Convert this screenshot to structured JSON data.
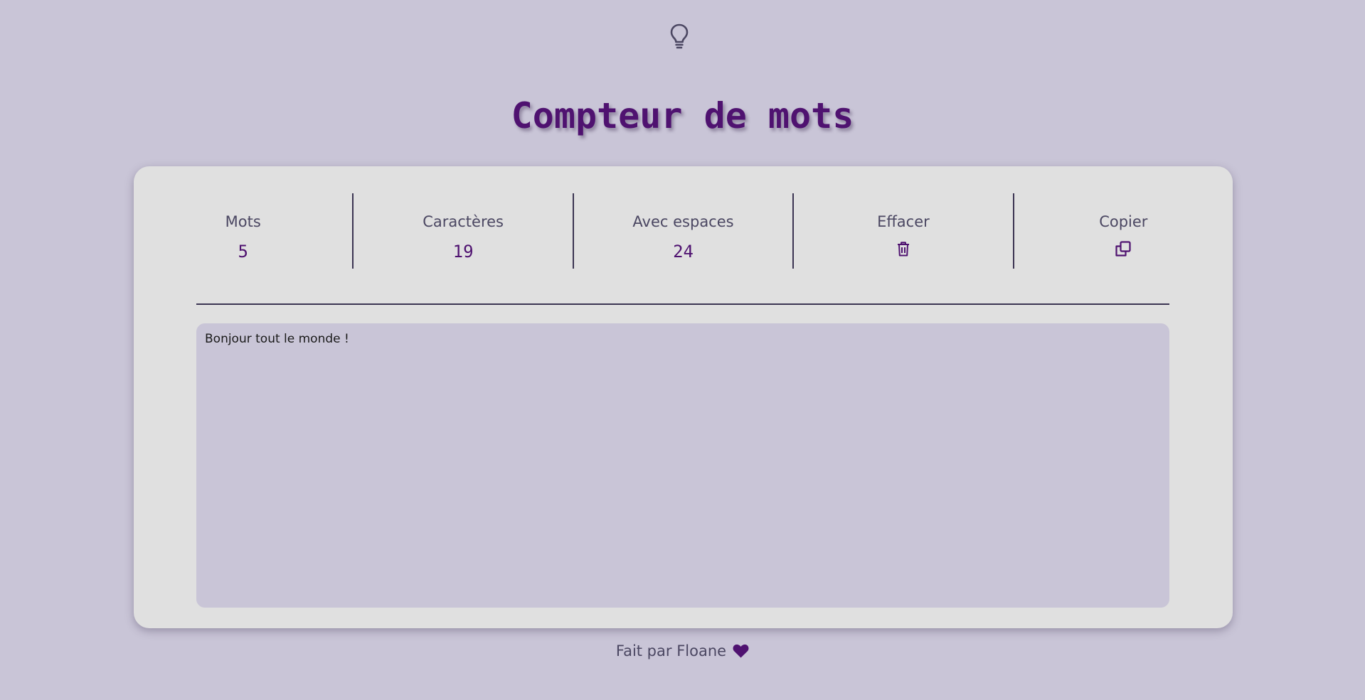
{
  "header": {
    "theme_toggle_icon": "lightbulb-icon",
    "title": "Compteur de mots"
  },
  "stats": [
    {
      "label": "Mots",
      "value": "5"
    },
    {
      "label": "Caractères",
      "value": "19"
    },
    {
      "label": "Avec espaces",
      "value": "24"
    }
  ],
  "actions": {
    "clear": {
      "label": "Effacer",
      "icon": "trash-icon"
    },
    "copy": {
      "label": "Copier",
      "icon": "copy-icon"
    }
  },
  "editor": {
    "value": "Bonjour tout le monde !"
  },
  "footer": {
    "text": "Fait par Floane",
    "icon": "heart-icon"
  },
  "colors": {
    "background": "#c9c5d7",
    "card": "#e0e0e0",
    "accent": "#4f1270",
    "text_muted": "#4b4762"
  }
}
